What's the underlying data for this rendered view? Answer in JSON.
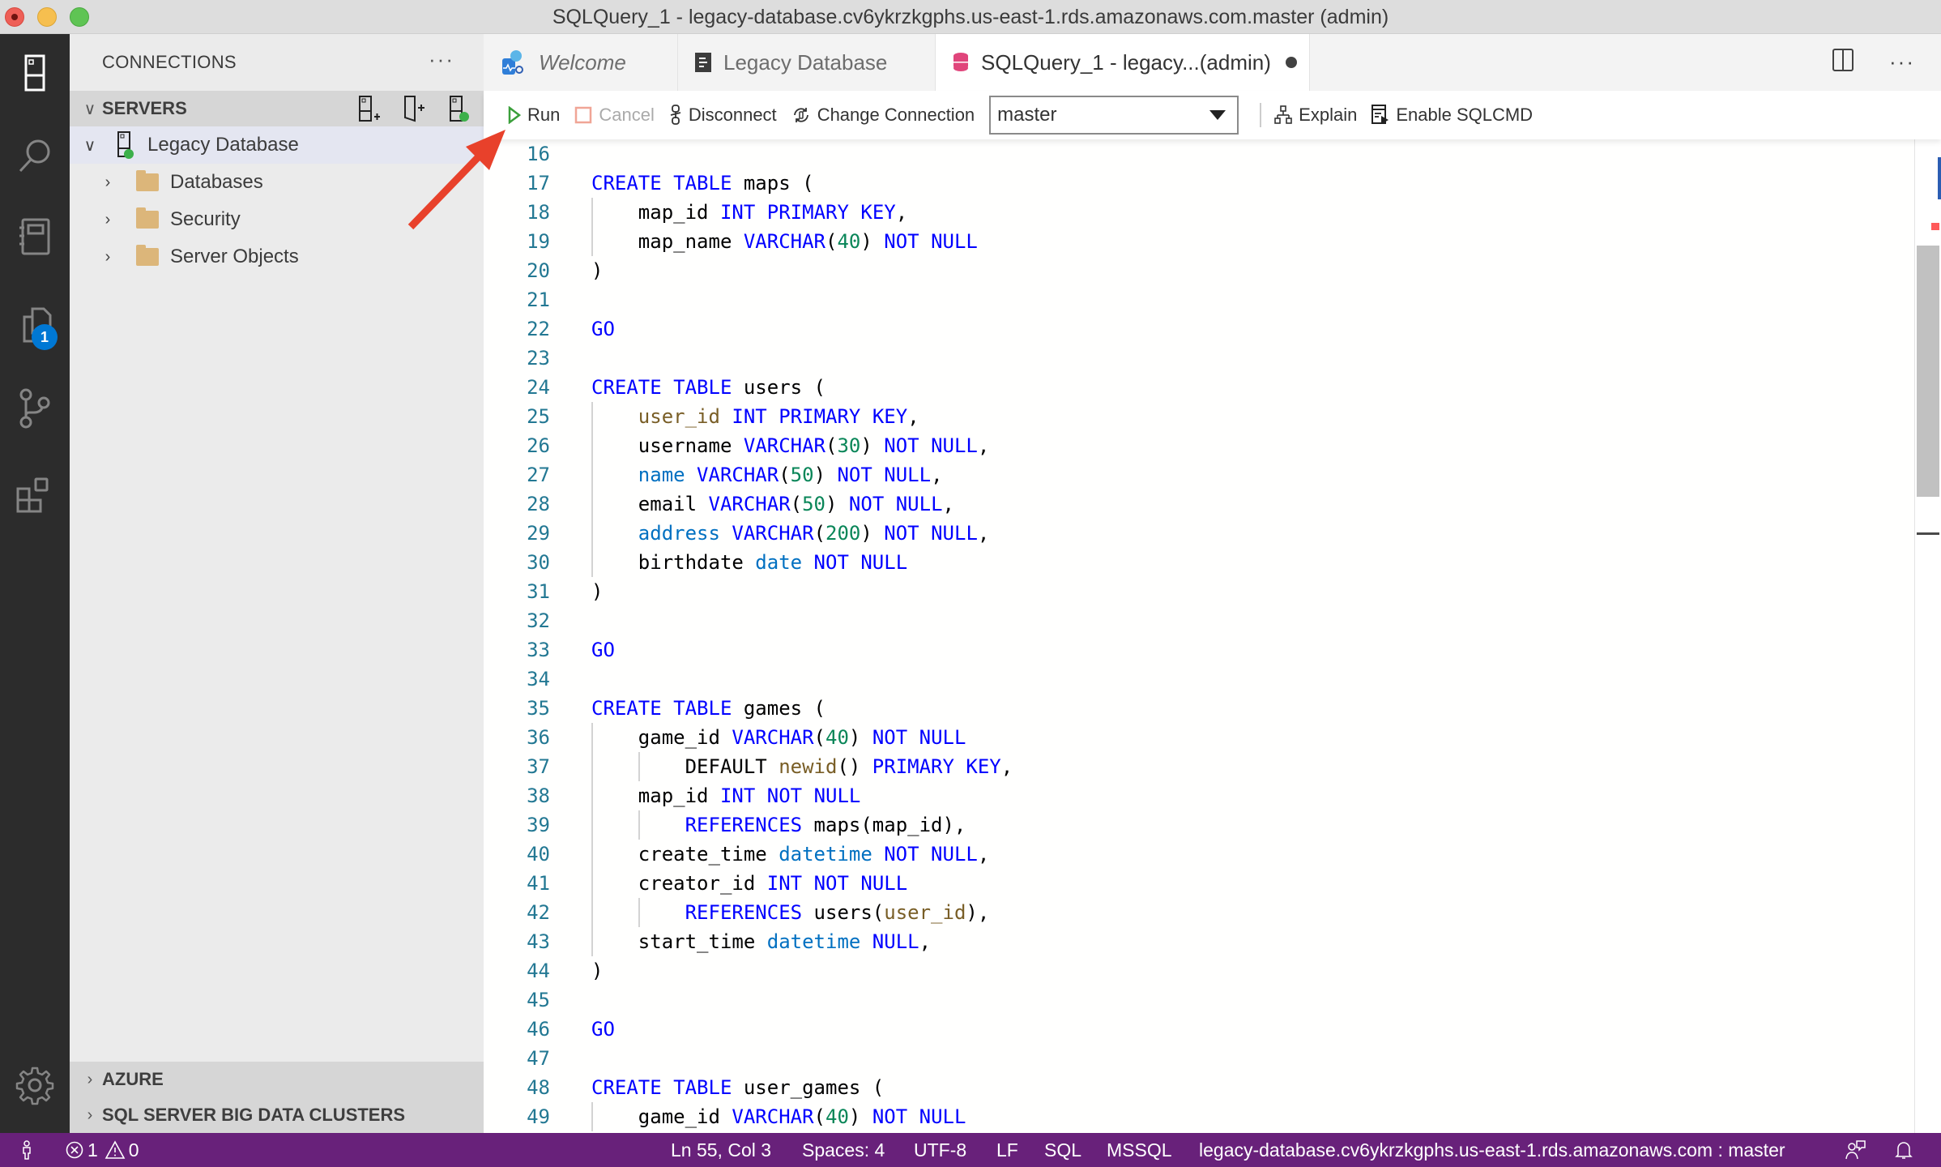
{
  "window": {
    "title": "SQLQuery_1 - legacy-database.cv6ykrzkgphs.us-east-1.rds.amazonaws.com.master (admin)"
  },
  "activity_bar": {
    "items": [
      {
        "name": "connections",
        "icon": "server-icon"
      },
      {
        "name": "search",
        "icon": "search-icon"
      },
      {
        "name": "notebooks",
        "icon": "notebook-icon"
      },
      {
        "name": "explorer",
        "icon": "files-icon",
        "badge": "1"
      },
      {
        "name": "source-control",
        "icon": "source-control-icon"
      },
      {
        "name": "extensions",
        "icon": "extensions-icon"
      }
    ],
    "settings_icon": "gear-icon"
  },
  "sidebar": {
    "title": "CONNECTIONS",
    "more_label": "···",
    "servers_section": {
      "label": "SERVERS",
      "actions": [
        "new-connection-icon",
        "new-server-group-icon",
        "active-connections-icon"
      ]
    },
    "tree": [
      {
        "label": "Legacy Database",
        "expanded": true,
        "connected": true,
        "level": 0
      },
      {
        "label": "Databases",
        "expanded": false,
        "level": 1
      },
      {
        "label": "Security",
        "expanded": false,
        "level": 1
      },
      {
        "label": "Server Objects",
        "expanded": false,
        "level": 1
      }
    ],
    "bottom_sections": [
      {
        "label": "AZURE"
      },
      {
        "label": "SQL SERVER BIG DATA CLUSTERS"
      }
    ]
  },
  "tabs": [
    {
      "label": "Welcome",
      "icon": "welcome-icon",
      "active": false,
      "italic": true
    },
    {
      "label": "Legacy Database",
      "icon": "dashboard-icon",
      "active": false
    },
    {
      "label": "SQLQuery_1 - legacy...(admin)",
      "icon": "database-icon",
      "active": true,
      "dirty": true
    }
  ],
  "tab_actions": {
    "split": "split-editor-icon",
    "more": "···"
  },
  "toolbar": {
    "run_label": "Run",
    "cancel_label": "Cancel",
    "disconnect_label": "Disconnect",
    "change_connection_label": "Change Connection",
    "database_selected": "master",
    "explain_label": "Explain",
    "sqlcmd_label": "Enable SQLCMD"
  },
  "editor": {
    "lines": [
      {
        "n": "16",
        "tokens": []
      },
      {
        "n": "17",
        "tokens": [
          [
            "kw",
            "CREATE"
          ],
          [
            "t",
            " "
          ],
          [
            "kw",
            "TABLE"
          ],
          [
            "t",
            " maps ("
          ]
        ]
      },
      {
        "n": "18",
        "indent": 1,
        "tokens": [
          [
            "t",
            "    map_id "
          ],
          [
            "kw",
            "INT"
          ],
          [
            "t",
            " "
          ],
          [
            "kw",
            "PRIMARY"
          ],
          [
            "t",
            " "
          ],
          [
            "kw",
            "KEY"
          ],
          [
            "t",
            ","
          ]
        ]
      },
      {
        "n": "19",
        "indent": 1,
        "tokens": [
          [
            "t",
            "    map_name "
          ],
          [
            "kw",
            "VARCHAR"
          ],
          [
            "t",
            "("
          ],
          [
            "num",
            "40"
          ],
          [
            "t",
            ") "
          ],
          [
            "kw",
            "NOT"
          ],
          [
            "t",
            " "
          ],
          [
            "kw",
            "NULL"
          ]
        ]
      },
      {
        "n": "20",
        "tokens": [
          [
            "t",
            ")"
          ]
        ]
      },
      {
        "n": "21",
        "tokens": []
      },
      {
        "n": "22",
        "tokens": [
          [
            "kw",
            "GO"
          ]
        ]
      },
      {
        "n": "23",
        "tokens": []
      },
      {
        "n": "24",
        "tokens": [
          [
            "kw",
            "CREATE"
          ],
          [
            "t",
            " "
          ],
          [
            "kw",
            "TABLE"
          ],
          [
            "t",
            " users ("
          ]
        ]
      },
      {
        "n": "25",
        "indent": 1,
        "tokens": [
          [
            "t",
            "    "
          ],
          [
            "fn",
            "user_id"
          ],
          [
            "t",
            " "
          ],
          [
            "kw",
            "INT"
          ],
          [
            "t",
            " "
          ],
          [
            "kw",
            "PRIMARY"
          ],
          [
            "t",
            " "
          ],
          [
            "kw",
            "KEY"
          ],
          [
            "t",
            ","
          ]
        ]
      },
      {
        "n": "26",
        "indent": 1,
        "tokens": [
          [
            "t",
            "    username "
          ],
          [
            "kw",
            "VARCHAR"
          ],
          [
            "t",
            "("
          ],
          [
            "num",
            "30"
          ],
          [
            "t",
            ") "
          ],
          [
            "kw",
            "NOT"
          ],
          [
            "t",
            " "
          ],
          [
            "kw",
            "NULL"
          ],
          [
            "t",
            ","
          ]
        ]
      },
      {
        "n": "27",
        "indent": 1,
        "tokens": [
          [
            "t",
            "    "
          ],
          [
            "kw2",
            "name"
          ],
          [
            "t",
            " "
          ],
          [
            "kw",
            "VARCHAR"
          ],
          [
            "t",
            "("
          ],
          [
            "num",
            "50"
          ],
          [
            "t",
            ") "
          ],
          [
            "kw",
            "NOT"
          ],
          [
            "t",
            " "
          ],
          [
            "kw",
            "NULL"
          ],
          [
            "t",
            ","
          ]
        ]
      },
      {
        "n": "28",
        "indent": 1,
        "tokens": [
          [
            "t",
            "    email "
          ],
          [
            "kw",
            "VARCHAR"
          ],
          [
            "t",
            "("
          ],
          [
            "num",
            "50"
          ],
          [
            "t",
            ") "
          ],
          [
            "kw",
            "NOT"
          ],
          [
            "t",
            " "
          ],
          [
            "kw",
            "NULL"
          ],
          [
            "t",
            ","
          ]
        ]
      },
      {
        "n": "29",
        "indent": 1,
        "tokens": [
          [
            "t",
            "    "
          ],
          [
            "kw2",
            "address"
          ],
          [
            "t",
            " "
          ],
          [
            "kw",
            "VARCHAR"
          ],
          [
            "t",
            "("
          ],
          [
            "num",
            "200"
          ],
          [
            "t",
            ") "
          ],
          [
            "kw",
            "NOT"
          ],
          [
            "t",
            " "
          ],
          [
            "kw",
            "NULL"
          ],
          [
            "t",
            ","
          ]
        ]
      },
      {
        "n": "30",
        "indent": 1,
        "tokens": [
          [
            "t",
            "    birthdate "
          ],
          [
            "kw2",
            "date"
          ],
          [
            "t",
            " "
          ],
          [
            "kw",
            "NOT"
          ],
          [
            "t",
            " "
          ],
          [
            "kw",
            "NULL"
          ]
        ]
      },
      {
        "n": "31",
        "tokens": [
          [
            "t",
            ")"
          ]
        ]
      },
      {
        "n": "32",
        "tokens": []
      },
      {
        "n": "33",
        "tokens": [
          [
            "kw",
            "GO"
          ]
        ]
      },
      {
        "n": "34",
        "tokens": []
      },
      {
        "n": "35",
        "tokens": [
          [
            "kw",
            "CREATE"
          ],
          [
            "t",
            " "
          ],
          [
            "kw",
            "TABLE"
          ],
          [
            "t",
            " games ("
          ]
        ]
      },
      {
        "n": "36",
        "indent": 1,
        "tokens": [
          [
            "t",
            "    game_id "
          ],
          [
            "kw",
            "VARCHAR"
          ],
          [
            "t",
            "("
          ],
          [
            "num",
            "40"
          ],
          [
            "t",
            ") "
          ],
          [
            "kw",
            "NOT"
          ],
          [
            "t",
            " "
          ],
          [
            "kw",
            "NULL"
          ]
        ]
      },
      {
        "n": "37",
        "indent": 2,
        "tokens": [
          [
            "t",
            "        DEFAULT "
          ],
          [
            "fn",
            "newid"
          ],
          [
            "t",
            "() "
          ],
          [
            "kw",
            "PRIMARY"
          ],
          [
            "t",
            " "
          ],
          [
            "kw",
            "KEY"
          ],
          [
            "t",
            ","
          ]
        ]
      },
      {
        "n": "38",
        "indent": 1,
        "tokens": [
          [
            "t",
            "    map_id "
          ],
          [
            "kw",
            "INT"
          ],
          [
            "t",
            " "
          ],
          [
            "kw",
            "NOT"
          ],
          [
            "t",
            " "
          ],
          [
            "kw",
            "NULL"
          ]
        ]
      },
      {
        "n": "39",
        "indent": 2,
        "tokens": [
          [
            "t",
            "        "
          ],
          [
            "kw",
            "REFERENCES"
          ],
          [
            "t",
            " maps(map_id),"
          ]
        ]
      },
      {
        "n": "40",
        "indent": 1,
        "tokens": [
          [
            "t",
            "    create_time "
          ],
          [
            "kw2",
            "datetime"
          ],
          [
            "t",
            " "
          ],
          [
            "kw",
            "NOT"
          ],
          [
            "t",
            " "
          ],
          [
            "kw",
            "NULL"
          ],
          [
            "t",
            ","
          ]
        ]
      },
      {
        "n": "41",
        "indent": 1,
        "tokens": [
          [
            "t",
            "    creator_id "
          ],
          [
            "kw",
            "INT"
          ],
          [
            "t",
            " "
          ],
          [
            "kw",
            "NOT"
          ],
          [
            "t",
            " "
          ],
          [
            "kw",
            "NULL"
          ]
        ]
      },
      {
        "n": "42",
        "indent": 2,
        "tokens": [
          [
            "t",
            "        "
          ],
          [
            "kw",
            "REFERENCES"
          ],
          [
            "t",
            " users("
          ],
          [
            "fn",
            "user_id"
          ],
          [
            "t",
            "),"
          ]
        ]
      },
      {
        "n": "43",
        "indent": 1,
        "tokens": [
          [
            "t",
            "    start_time "
          ],
          [
            "kw2",
            "datetime"
          ],
          [
            "t",
            " "
          ],
          [
            "kw",
            "NULL"
          ],
          [
            "t",
            ","
          ]
        ]
      },
      {
        "n": "44",
        "tokens": [
          [
            "t",
            ")"
          ]
        ]
      },
      {
        "n": "45",
        "tokens": []
      },
      {
        "n": "46",
        "tokens": [
          [
            "kw",
            "GO"
          ]
        ]
      },
      {
        "n": "47",
        "tokens": []
      },
      {
        "n": "48",
        "tokens": [
          [
            "kw",
            "CREATE"
          ],
          [
            "t",
            " "
          ],
          [
            "kw",
            "TABLE"
          ],
          [
            "t",
            " user_games ("
          ]
        ]
      },
      {
        "n": "49",
        "indent": 1,
        "tokens": [
          [
            "t",
            "    game_id "
          ],
          [
            "kw",
            "VARCHAR"
          ],
          [
            "t",
            "("
          ],
          [
            "num",
            "40"
          ],
          [
            "t",
            ") "
          ],
          [
            "kw",
            "NOT"
          ],
          [
            "t",
            " "
          ],
          [
            "kw",
            "NULL"
          ]
        ]
      }
    ],
    "colors": {
      "keyword": "#0000ff",
      "type_keyword": "#0070c1",
      "number": "#098658",
      "function": "#795e26",
      "line_number": "#237893"
    }
  },
  "statusbar": {
    "errors": "1",
    "warnings": "0",
    "cursor": "Ln 55, Col 3",
    "spaces": "Spaces: 4",
    "encoding": "UTF-8",
    "eol": "LF",
    "language": "SQL",
    "provider": "MSSQL",
    "connection": "legacy-database.cv6ykrzkgphs.us-east-1.rds.amazonaws.com : master",
    "background": "#68217a"
  },
  "annotation": {
    "type": "arrow",
    "color": "#e8412b",
    "points_to": "run-button"
  }
}
